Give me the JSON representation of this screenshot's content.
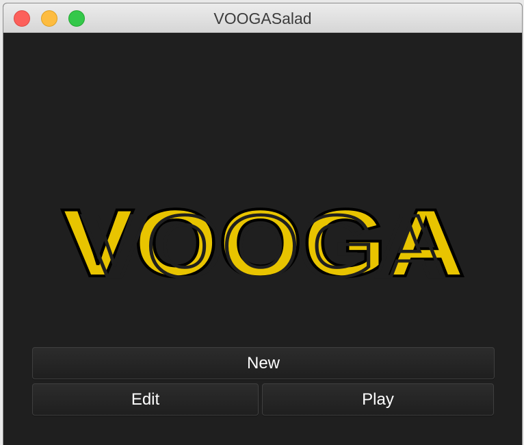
{
  "window": {
    "title": "VOOGASalad"
  },
  "logo": {
    "text": "VOOGA",
    "color": "#e8c400",
    "outline": "#000000"
  },
  "buttons": {
    "new": "New",
    "edit": "Edit",
    "play": "Play"
  }
}
